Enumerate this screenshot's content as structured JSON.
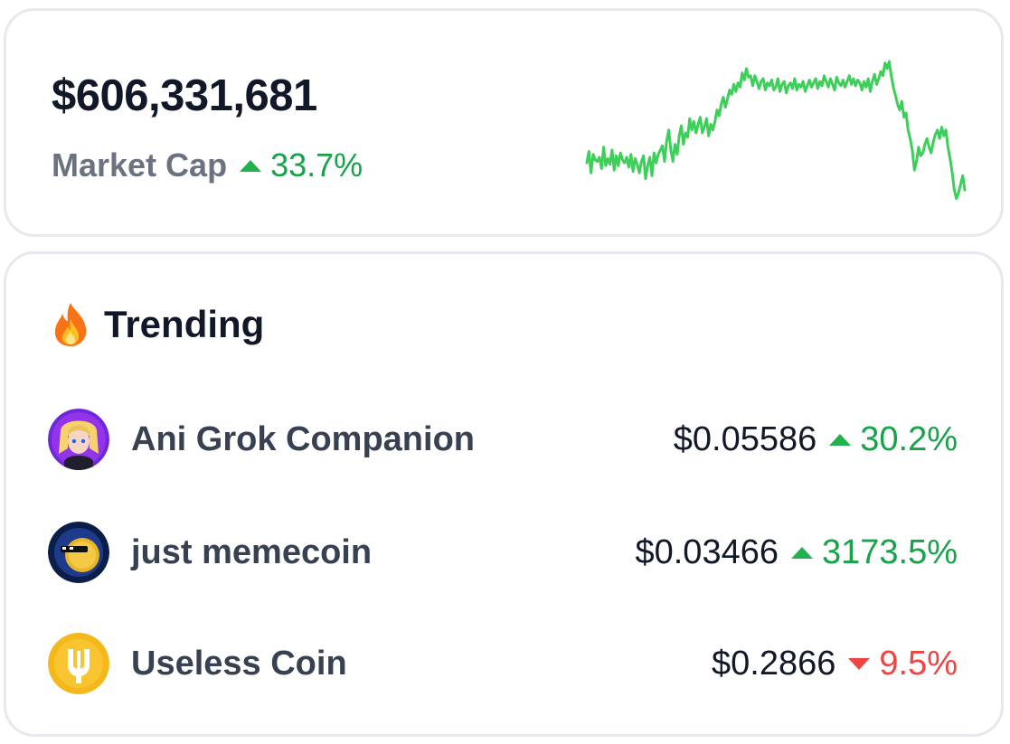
{
  "market": {
    "value": "$606,331,681",
    "label": "Market Cap",
    "change": "33.7%",
    "direction": "up",
    "sparkline_color": "#3ecf5a",
    "sparkline": [
      0.29,
      0.37,
      0.22,
      0.35,
      0.31,
      0.3,
      0.33,
      0.25,
      0.4,
      0.27,
      0.32,
      0.28,
      0.38,
      0.24,
      0.34,
      0.27,
      0.36,
      0.31,
      0.29,
      0.33,
      0.26,
      0.35,
      0.23,
      0.32,
      0.28,
      0.22,
      0.3,
      0.34,
      0.18,
      0.27,
      0.33,
      0.2,
      0.36,
      0.29,
      0.35,
      0.38,
      0.41,
      0.3,
      0.44,
      0.52,
      0.38,
      0.3,
      0.42,
      0.35,
      0.48,
      0.55,
      0.42,
      0.5,
      0.47,
      0.6,
      0.52,
      0.58,
      0.5,
      0.56,
      0.61,
      0.5,
      0.54,
      0.6,
      0.48,
      0.56,
      0.52,
      0.58,
      0.66,
      0.62,
      0.7,
      0.75,
      0.68,
      0.74,
      0.8,
      0.77,
      0.84,
      0.79,
      0.85,
      0.82,
      0.92,
      0.87,
      0.95,
      0.89,
      0.9,
      0.83,
      0.9,
      0.86,
      0.81,
      0.86,
      0.88,
      0.8,
      0.85,
      0.83,
      0.87,
      0.8,
      0.82,
      0.88,
      0.79,
      0.84,
      0.86,
      0.78,
      0.83,
      0.85,
      0.81,
      0.88,
      0.8,
      0.84,
      0.82,
      0.86,
      0.79,
      0.83,
      0.87,
      0.82,
      0.85,
      0.88,
      0.81,
      0.86,
      0.83,
      0.9,
      0.86,
      0.82,
      0.88,
      0.84,
      0.8,
      0.89,
      0.85,
      0.83,
      0.87,
      0.82,
      0.86,
      0.9,
      0.84,
      0.88,
      0.83,
      0.87,
      0.85,
      0.8,
      0.86,
      0.82,
      0.88,
      0.79,
      0.86,
      0.91,
      0.84,
      0.88,
      0.93,
      0.9,
      0.99,
      0.95,
      1.0,
      0.9,
      0.82,
      0.76,
      0.7,
      0.66,
      0.72,
      0.61,
      0.64,
      0.52,
      0.46,
      0.38,
      0.24,
      0.3,
      0.4,
      0.34,
      0.36,
      0.42,
      0.46,
      0.4,
      0.36,
      0.44,
      0.49,
      0.52,
      0.46,
      0.54,
      0.48,
      0.52,
      0.4,
      0.32,
      0.22,
      0.1,
      0.04,
      0.08,
      0.14,
      0.2,
      0.1
    ]
  },
  "trending": {
    "title": "Trending",
    "items": [
      {
        "name": "Ani Grok Companion",
        "price": "$0.05586",
        "change": "30.2%",
        "direction": "up"
      },
      {
        "name": "just memecoin",
        "price": "$0.03466",
        "change": "3173.5%",
        "direction": "up"
      },
      {
        "name": "Useless Coin",
        "price": "$0.2866",
        "change": "9.5%",
        "direction": "down"
      }
    ]
  },
  "colors": {
    "up": "#16a34a",
    "down": "#ef4444",
    "text_primary": "#111827",
    "text_muted": "#6b7280",
    "card_border": "#e6e9ee"
  }
}
